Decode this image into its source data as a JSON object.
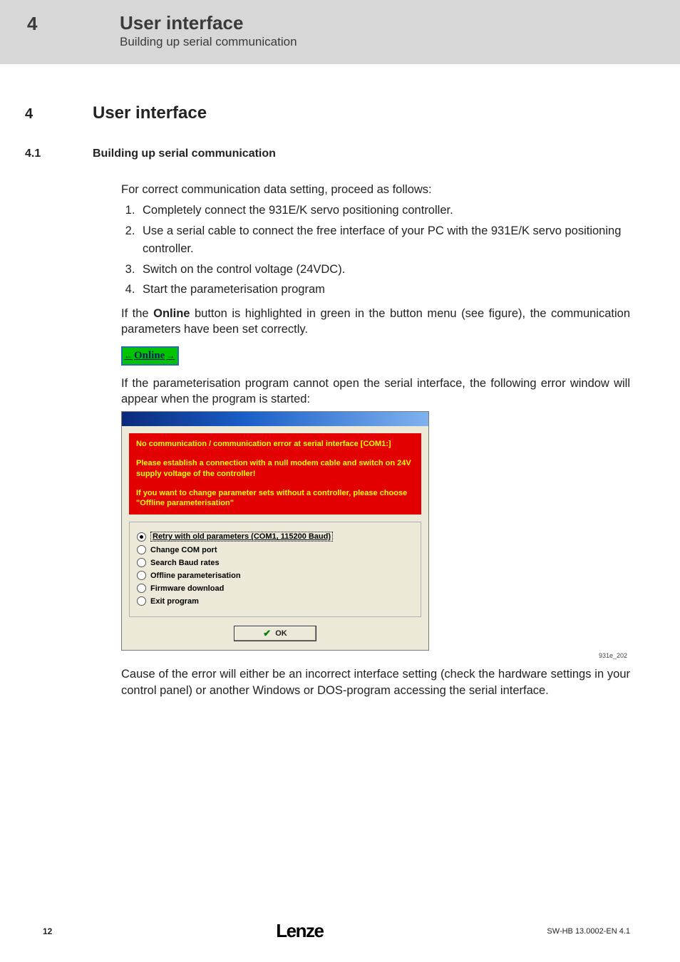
{
  "header": {
    "chapter_num": "4",
    "title": "User interface",
    "subtitle": "Building up serial communication"
  },
  "section": {
    "num": "4",
    "title": "User interface"
  },
  "subsection": {
    "num": "4.1",
    "title": "Building up serial communication"
  },
  "intro_para": "For correct communication data setting, proceed as follows:",
  "steps": [
    "Completely connect the 931E/K servo positioning controller.",
    "Use a serial cable to connect the free interface of your PC with the 931E/K servo positioning controller.",
    "Switch on the control voltage (24VDC).",
    "Start the parameterisation program"
  ],
  "para_online_pre": "If the ",
  "para_online_bold": "Online",
  "para_online_post": " button is highlighted in green in the button menu (see figure), the communication parameters have been set correctly.",
  "online_btn_label": "Online",
  "para_error": "If the parameterisation program cannot open the serial interface, the following error window will appear when the program is started:",
  "dialog": {
    "line1": "No communication / communication error at serial interface [COM1:]",
    "line2": "Please establish a connection with a null modem cable and switch on 24V supply voltage of the controller!",
    "line3": "If you want to change parameter sets without a controller, please choose \"Offline parameterisation\"",
    "options": [
      "Retry with old parameters (COM1, 115200 Baud)",
      "Change COM port",
      "Search Baud rates",
      "Offline parameterisation",
      "Firmware download",
      "Exit program"
    ],
    "ok_label": "OK"
  },
  "fig_ref": "931e_202",
  "para_cause": "Cause of the error will either be an incorrect interface setting (check the hardware settings in your control panel) or another Windows or DOS-program accessing the serial interface.",
  "footer": {
    "page_num": "12",
    "brand": "Lenze",
    "doc_id": "SW-HB 13.0002-EN   4.1"
  }
}
